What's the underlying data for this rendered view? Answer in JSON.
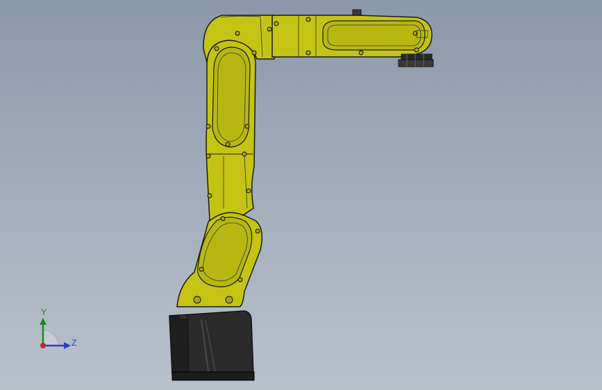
{
  "viewport": {
    "background_top": "#8b98a9",
    "background_bottom": "#b9c1cb"
  },
  "model": {
    "description_icon": "robot-arm",
    "body_color": "#c5c414",
    "shade_color": "#a7a60f",
    "base_color": "#2a2a2a",
    "edge_color": "#1a1a1a"
  },
  "triad": {
    "y_label": "Y",
    "z_label": "Z",
    "y_color": "#1e8a1e",
    "z_color": "#2b3fbf",
    "x_color": "#c0282d"
  }
}
